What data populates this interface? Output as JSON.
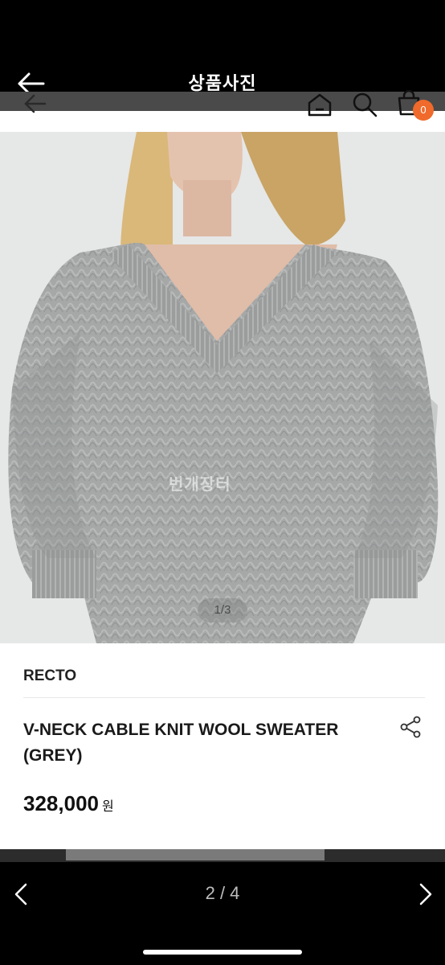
{
  "header": {
    "title": "상품사진",
    "back_icon": "arrow-left-icon"
  },
  "app_toolbar": {
    "icons": [
      "home-icon",
      "search-icon",
      "shopping-bag-icon"
    ],
    "cart_count": "0",
    "badge_color": "#f06a2b"
  },
  "photo": {
    "counter": "1/3",
    "watermark": "번개장터",
    "subject": "grey v-neck cable knit sweater"
  },
  "product": {
    "brand": "RECTO",
    "name": "V-NECK CABLE KNIT WOOL SWEATER (GREY)",
    "price": "328,000",
    "price_unit": "원",
    "share_icon": "share-icon"
  },
  "footer": {
    "page_indicator": "2 / 4",
    "prev_icon": "chevron-left-icon",
    "next_icon": "chevron-right-icon"
  }
}
